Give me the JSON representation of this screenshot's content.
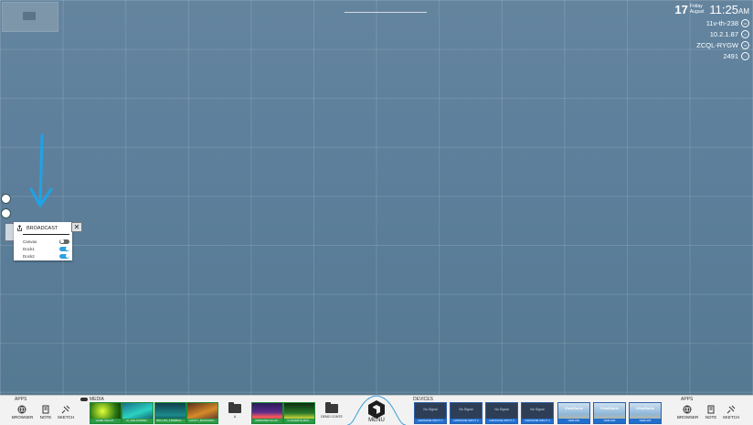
{
  "status": {
    "day": "17",
    "weekday": "Friday",
    "month": "August",
    "time": "11:25",
    "ampm": "AM",
    "hostname": "11v-th-238",
    "ip": "10.2.1.87",
    "code": "ZCQL-RYGW",
    "pin": "2491"
  },
  "broadcast": {
    "title": "BROADCAST",
    "close": "✕",
    "options": [
      {
        "label": "Canvas",
        "on": false
      },
      {
        "label": "Dock1",
        "on": true
      },
      {
        "label": "Dock2",
        "on": true
      }
    ]
  },
  "bottom": {
    "apps_label_left": "APPS",
    "media_label": "MEDIA",
    "devices_label": "DEVICES",
    "apps_label_right": "APPS",
    "menu_label": "MENU",
    "apps_left": [
      {
        "label": "BROWSER",
        "icon": "globe-icon"
      },
      {
        "label": "NOTE",
        "icon": "note-icon"
      },
      {
        "label": "SKETCH",
        "icon": "sketch-icon"
      }
    ],
    "apps_right": [
      {
        "label": "BROWSER",
        "icon": "globe-icon"
      },
      {
        "label": "NOTE",
        "icon": "note-icon"
      },
      {
        "label": "SKETCH",
        "icon": "sketch-icon"
      }
    ],
    "media": [
      {
        "label": "GAME WALLP..."
      },
      {
        "label": "AI_WALLPAPER..."
      },
      {
        "label": "BALLON_FIREBALL..."
      },
      {
        "label": "GOOFY_BACKGRO..."
      },
      {
        "label": "A",
        "folder": true
      },
      {
        "label": "ANIMATED AA-20..."
      },
      {
        "label": "CONCERTE-BOX..."
      },
      {
        "label": "DEMO CONTE",
        "folder": true
      }
    ],
    "devices": [
      {
        "label": "HARDLINE INPUT 1",
        "title": "No Signal"
      },
      {
        "label": "HARDLINE INPUT 2",
        "title": "No Signal"
      },
      {
        "label": "HARDLINE INPUT 3",
        "title": "No Signal"
      },
      {
        "label": "HARDLINE INPUT 4",
        "title": "No Signal"
      },
      {
        "label": "NEM-001",
        "title": "ViewSonic"
      },
      {
        "label": "NEM-002",
        "title": "ViewSonic"
      },
      {
        "label": "NEM-003",
        "title": "ViewSonic"
      }
    ]
  }
}
